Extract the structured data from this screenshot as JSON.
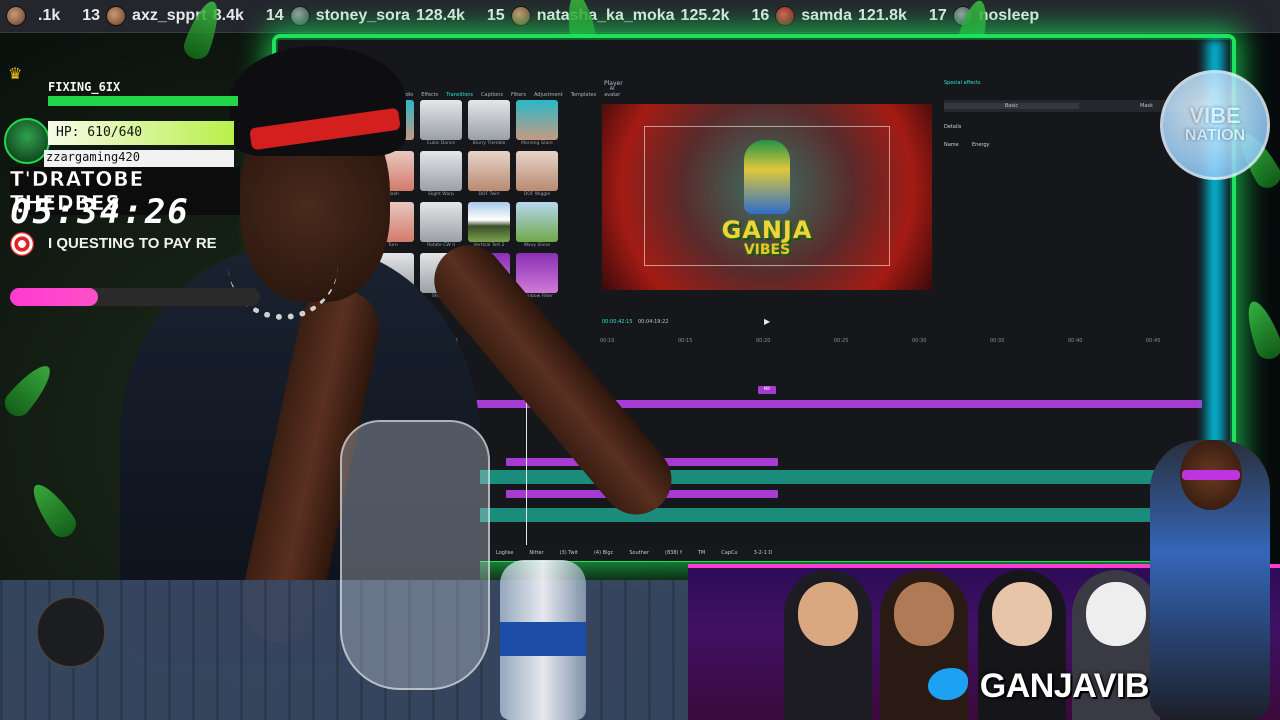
{
  "ticker": [
    {
      "rank": "",
      "name": "",
      "count": ".1k"
    },
    {
      "rank": "13",
      "name": "axz_spprt",
      "count": "8.4k"
    },
    {
      "rank": "14",
      "name": "stoney_sora",
      "count": "128.4k"
    },
    {
      "rank": "15",
      "name": "natasha_ka_moka",
      "count": "125.2k"
    },
    {
      "rank": "16",
      "name": "samda",
      "count": "121.8k"
    },
    {
      "rank": "17",
      "name": "nosleep",
      "count": ""
    }
  ],
  "hud": {
    "name": "FIXING_6IX",
    "hp": "HP: 610/640",
    "user": "zzargaming420",
    "headline": "T'DRATOBE THEDBES",
    "timer": "05:34:26",
    "goal": "I QUESTING TO PAY RE",
    "goal_progress": 0.35
  },
  "editor": {
    "tabs": [
      "Media",
      "Audio",
      "Effects",
      "Transitions",
      "Captions",
      "Filters",
      "Adjustment",
      "Templates",
      "AI avatar"
    ],
    "active_tab": "Transitions",
    "player_title": "Player",
    "side_title": "Special effects",
    "side_tabs": [
      "Basic",
      "Mask"
    ],
    "details_label": "Details",
    "name_label": "Name",
    "name_value": "Energy",
    "current_time": "00:00:42:15",
    "duration": "00:04:19:22",
    "play_icon": "▶",
    "logo_line1": "GANJA",
    "logo_line2": "VIBES",
    "clip_tag": "Mill",
    "thumbnails": [
      {
        "label": "Blur 1",
        "style": "t-person"
      },
      {
        "label": "Cubic Dance",
        "style": ""
      },
      {
        "label": "Blurry Tremble",
        "style": ""
      },
      {
        "label": "Morning Glare",
        "style": "t-person"
      },
      {
        "label": "Flash",
        "style": "t-red"
      },
      {
        "label": "Slight Warp",
        "style": ""
      },
      {
        "label": "DOF Twirl",
        "style": "t-hand"
      },
      {
        "label": "DOF Wiggle",
        "style": "t-hand"
      },
      {
        "label": "Turn",
        "style": "t-red"
      },
      {
        "label": "Rotate CW II",
        "style": ""
      },
      {
        "label": "Vertical Tort 2",
        "style": "t-mount"
      },
      {
        "label": "Wavy Slices",
        "style": "t-green"
      },
      {
        "label": "Lockable",
        "style": ""
      },
      {
        "label": "Shake 3",
        "style": ""
      },
      {
        "label": "Rainbow",
        "style": "t-purple"
      },
      {
        "label": "Rainbow Filter",
        "style": "t-purple"
      }
    ],
    "ruler": [
      "00:00",
      "00:01",
      "00:05",
      "00:10",
      "00:15",
      "00:20",
      "00:25",
      "00:30",
      "00:35",
      "00:40",
      "00:45"
    ]
  },
  "taskbar": [
    "Scene 5",
    "Loglise",
    "Nitter",
    "(3) Twit",
    "(4) Bigc",
    "Souther",
    "(838) f",
    "TM",
    "CapCu",
    "3-2-1 D"
  ],
  "badge": {
    "line1": "VIBE",
    "line2": "NATION"
  },
  "brand": {
    "text": "GANJAVIBESTTV"
  },
  "colors": {
    "accent_green": "#1ee35a",
    "accent_cyan": "#2de6d8",
    "accent_pink": "#ff3bd1",
    "track_purple": "#a53bd0"
  }
}
